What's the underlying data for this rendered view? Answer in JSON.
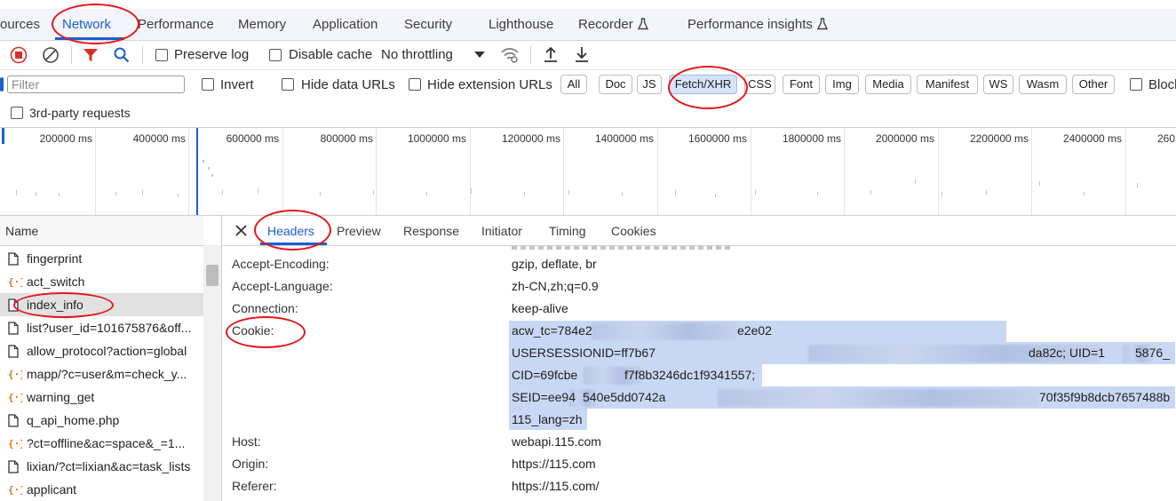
{
  "tabbar": {
    "tabs": [
      {
        "label": "ources"
      },
      {
        "label": "Network"
      },
      {
        "label": "Performance"
      },
      {
        "label": "Memory"
      },
      {
        "label": "Application"
      },
      {
        "label": "Security"
      },
      {
        "label": "Lighthouse"
      },
      {
        "label": "Recorder"
      },
      {
        "label": "Performance insights"
      }
    ]
  },
  "toolbar": {
    "preserve_log": "Preserve log",
    "disable_cache": "Disable cache",
    "throttling": "No throttling"
  },
  "filterbar": {
    "filter_placeholder": "Filter",
    "invert": "Invert",
    "hide_data_urls": "Hide data URLs",
    "hide_extension_urls": "Hide extension URLs",
    "types": [
      "All",
      "Doc",
      "JS",
      "Fetch/XHR",
      "CSS",
      "Font",
      "Img",
      "Media",
      "Manifest",
      "WS",
      "Wasm",
      "Other"
    ],
    "block": "Block",
    "third_party": "3rd-party requests"
  },
  "timeline": {
    "ticks": [
      "200000 ms",
      "400000 ms",
      "600000 ms",
      "800000 ms",
      "1000000 ms",
      "1200000 ms",
      "1400000 ms",
      "1600000 ms",
      "1800000 ms",
      "2000000 ms",
      "2200000 ms",
      "2400000 ms",
      "260"
    ]
  },
  "requests": {
    "column_name": "Name",
    "rows": [
      {
        "name": "fingerprint",
        "kind": "doc"
      },
      {
        "name": "act_switch",
        "kind": "xhr"
      },
      {
        "name": "index_info",
        "kind": "doc"
      },
      {
        "name": "list?user_id=101675876&off...",
        "kind": "doc"
      },
      {
        "name": "allow_protocol?action=global",
        "kind": "doc"
      },
      {
        "name": "mapp/?c=user&m=check_y...",
        "kind": "xhr"
      },
      {
        "name": "warning_get",
        "kind": "xhr"
      },
      {
        "name": "q_api_home.php",
        "kind": "doc"
      },
      {
        "name": "?ct=offline&ac=space&_=1...",
        "kind": "xhr"
      },
      {
        "name": "lixian/?ct=lixian&ac=task_lists",
        "kind": "doc"
      },
      {
        "name": "applicant",
        "kind": "xhr"
      }
    ]
  },
  "details": {
    "tabs": [
      "Headers",
      "Preview",
      "Response",
      "Initiator",
      "Timing",
      "Cookies"
    ],
    "headers": [
      {
        "name": "Accept-Encoding:",
        "value": "gzip, deflate, br"
      },
      {
        "name": "Accept-Language:",
        "value": "zh-CN,zh;q=0.9"
      },
      {
        "name": "Connection:",
        "value": "keep-alive"
      },
      {
        "name": "Cookie:",
        "value": "acw_tc=784e2"
      }
    ],
    "cookie_lines": {
      "l1_end": "e2e02",
      "l2_start": "USERSESSIONID=ff7b67",
      "l2_end": "da82c; UID=1",
      "l2_tail": "5876_",
      "l3_start": "CID=69fcbe",
      "l3_end": "f7f8b3246dc1f9341557;",
      "l4_start": "SEID=ee94",
      "l4_mid": "540e5dd0742a",
      "l4_end": "70f35f9b8dcb7657488b",
      "l5": "115_lang=zh"
    },
    "headers_after": [
      {
        "name": "Host:",
        "value": "webapi.115.com"
      },
      {
        "name": "Origin:",
        "value": "https://115.com"
      },
      {
        "name": "Referer:",
        "value": "https://115.com/"
      }
    ]
  },
  "colors": {
    "accent": "#1a5fd0",
    "annotation": "#e5161b",
    "selection": "#c8d8f4"
  }
}
